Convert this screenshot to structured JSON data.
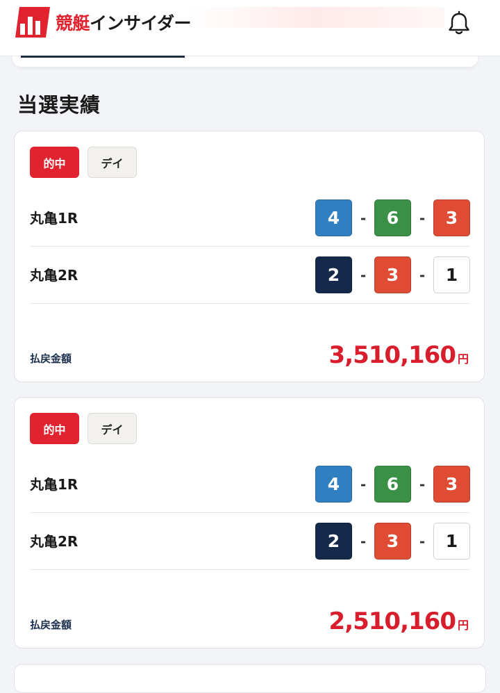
{
  "header": {
    "logo_red": "競艇",
    "logo_dark": "インサイダー",
    "notification_icon": "bell-icon"
  },
  "section": {
    "title": "当選実績"
  },
  "results": [
    {
      "badge_hit": "的中",
      "badge_type": "デイ",
      "races": [
        {
          "name": "丸亀1R",
          "numbers": [
            {
              "value": "4",
              "bg": "#2f7fc1",
              "fg": "#ffffff"
            },
            {
              "value": "6",
              "bg": "#3a9146",
              "fg": "#ffffff"
            },
            {
              "value": "3",
              "bg": "#df4b33",
              "fg": "#ffffff"
            }
          ]
        },
        {
          "name": "丸亀2R",
          "numbers": [
            {
              "value": "2",
              "bg": "#15294a",
              "fg": "#ffffff"
            },
            {
              "value": "3",
              "bg": "#df4b33",
              "fg": "#ffffff"
            },
            {
              "value": "1",
              "bg": "#ffffff",
              "fg": "#1a1a1a"
            }
          ]
        }
      ],
      "payout_label": "払戻金額",
      "payout_value": "3,510,160",
      "payout_unit": "円"
    },
    {
      "badge_hit": "的中",
      "badge_type": "デイ",
      "races": [
        {
          "name": "丸亀1R",
          "numbers": [
            {
              "value": "4",
              "bg": "#2f7fc1",
              "fg": "#ffffff"
            },
            {
              "value": "6",
              "bg": "#3a9146",
              "fg": "#ffffff"
            },
            {
              "value": "3",
              "bg": "#df4b33",
              "fg": "#ffffff"
            }
          ]
        },
        {
          "name": "丸亀2R",
          "numbers": [
            {
              "value": "2",
              "bg": "#15294a",
              "fg": "#ffffff"
            },
            {
              "value": "3",
              "bg": "#df4b33",
              "fg": "#ffffff"
            },
            {
              "value": "1",
              "bg": "#ffffff",
              "fg": "#1a1a1a"
            }
          ]
        }
      ],
      "payout_label": "払戻金額",
      "payout_value": "2,510,160",
      "payout_unit": "円"
    }
  ],
  "separator": "-",
  "colors": {
    "brand_red": "#e1232f",
    "payout_red": "#d81d2c",
    "label_navy": "#1b2f4c"
  }
}
